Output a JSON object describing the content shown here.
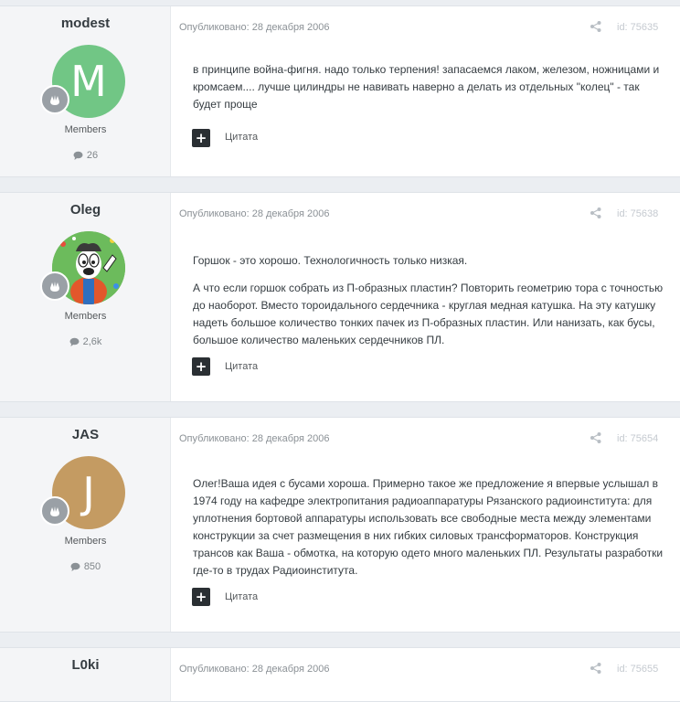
{
  "posts": [
    {
      "author": "modest",
      "avatar_letter": "M",
      "avatar_color": "#71c685",
      "group": "Members",
      "post_count": "26",
      "published": "Опубликовано: 28 декабря 2006",
      "post_id": "id: 75635",
      "paragraphs": [
        "в принципе война-фигня. надо только терпения! запасаемся лаком, железом, ножницами и кромсаем.... лучше цилиндры не навивать наверно а делать из отдельных \"колец\" - так будет проще"
      ],
      "quote_label": "Цитата"
    },
    {
      "author": "Oleg",
      "avatar_letter": "",
      "avatar_color": "#7dc26a",
      "group": "Members",
      "post_count": "2,6k",
      "published": "Опубликовано: 28 декабря 2006",
      "post_id": "id: 75638",
      "paragraphs": [
        "Горшок - это хорошо. Технологичность только низкая.",
        "А что если горшок собрать из П-образных пластин? Повторить геометрию тора с точностью до наоборот. Вместо тороидального сердечника - круглая медная катушка. На эту катушку надеть большое количество тонких пачек из П-образных пластин. Или нанизать, как бусы, большое количество маленьких сердечников ПЛ."
      ],
      "quote_label": "Цитата"
    },
    {
      "author": "JAS",
      "avatar_letter": "J",
      "avatar_color": "#c49b62",
      "group": "Members",
      "post_count": "850",
      "published": "Опубликовано: 28 декабря 2006",
      "post_id": "id: 75654",
      "paragraphs": [
        "Олег!Ваша идея с бусами хороша. Примерно такое же предложение я впервые услышал в 1974 году на кафедре электропитания радиоаппаратуры Рязанского радиоинститута: для уплотнения бортовой аппаратуры использовать все свободные места между элементами конструкции за счет размещения в них гибких силовых трансформаторов. Конструкция трансов как Ваша - обмотка, на которую одето много маленьких ПЛ. Результаты разработки где-то в трудах Радиоинститута."
      ],
      "quote_label": "Цитата"
    },
    {
      "author": "L0ki",
      "published": "Опубликовано: 28 декабря 2006",
      "post_id": "id: 75655"
    }
  ]
}
